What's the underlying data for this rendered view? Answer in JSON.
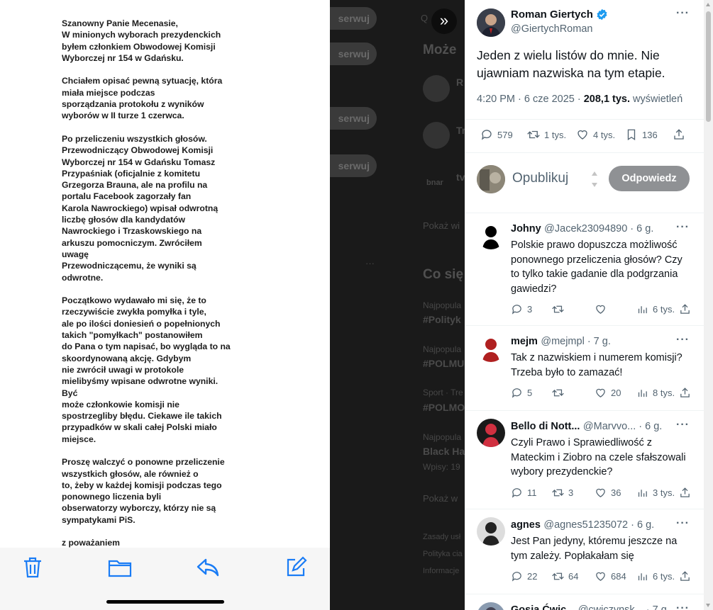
{
  "letter": {
    "paragraphs": [
      [
        "Szanowny Panie Mecenasie,",
        "W minionych wyborach prezydenckich",
        "byłem członkiem Obwodowej Komisji",
        "Wyborczej nr 154 w Gdańsku."
      ],
      [
        "Chciałem opisać pewną sytuację, która",
        "miała miejsce podczas",
        "sporządzania protokołu z wyników",
        "wyborów w II turze 1 czerwca."
      ],
      [
        "Po przeliczeniu wszystkich głosów.",
        "Przewodniczący Obwodowej Komisji",
        "Wyborczej nr 154 w Gdańsku Tomasz",
        "Przypaśniak (oficjalnie z komitetu",
        "Grzegorza Brauna, ale na profilu na",
        "portalu Facebook zagorzały fan",
        "Karola Nawrockiego) wpisał odwrotną",
        "liczbę głosów dla kandydatów",
        "Nawrockiego i Trzaskowskiego na",
        "arkuszu pomocniczym. Zwróciłem",
        "uwagę",
        "Przewodniczącemu, że wyniki są",
        "odwrotne."
      ],
      [
        "Początkowo wydawało mi się, że to",
        "rzeczywiście zwykła pomyłka i tyle,",
        "ale po ilości doniesień o popełnionych",
        "takich \"pomyłkach\" postanowiłem",
        "do Pana o tym napisać, bo wygląda to na",
        "skoordynowaną akcję. Gdybym",
        "nie zwrócił uwagi w protokole",
        "mielibyśmy wpisane odwrotne wyniki.",
        "Być",
        "może członkowie komisji nie",
        "spostrzegliby błędu. Ciekawe ile takich",
        "przypadków w skali całej Polski miało",
        "miejsce."
      ],
      [
        "Proszę walczyć o ponowne przeliczenie",
        "wszystkich głosów, ale również o",
        "to, żeby w każdej komisji podczas tego",
        "ponownego liczenia byli",
        "obserwatorzy wyborczy, którzy nie są",
        "sympatykami PiS."
      ],
      [
        "z poważaniem"
      ]
    ]
  },
  "backdrop": {
    "follow_label": "serwuj",
    "who_to_follow_heading": "Może",
    "show_more": "Pokaż wi",
    "trends_heading": "Co się",
    "trends": [
      {
        "meta": "Najpopula",
        "tag": "#Polityk"
      },
      {
        "meta": "Najpopula",
        "tag": "#POLMU"
      },
      {
        "meta": "Sport · Tre",
        "tag": "#POLMO"
      },
      {
        "meta": "Najpopula",
        "tag": "Black Ha"
      }
    ],
    "trend_sub": "Wpisy: 19",
    "show_more_2": "Pokaż w",
    "footer": [
      "Zasady usł",
      "Polityka cia",
      "Informacje"
    ],
    "account_initials": [
      "R",
      "Tr",
      "tv"
    ],
    "account_logo": "bnar",
    "search_hint": "Q",
    "dots": "···"
  },
  "tweet": {
    "author": "Roman Giertych",
    "handle": "@GiertychRoman",
    "text": "Jeden z wielu listów do mnie. Nie ujawniam nazwiska na tym etapie.",
    "time": "4:20 PM · 6 cze 2025 · ",
    "views_count": "208,1 tys.",
    "views_label": " wyświetleń",
    "stats": {
      "replies": "579",
      "reposts": "1 tys.",
      "likes": "4 tys.",
      "bookmarks": "136"
    },
    "verified_color": "#1d9bf0"
  },
  "composer": {
    "placeholder": "Opublikuj",
    "reply_button": "Odpowiedz"
  },
  "replies": [
    {
      "name": "Johny",
      "handle": "@Jacek23094890",
      "time": " · 6 g.",
      "text": "Polskie prawo dopuszcza możliwość ponownego przeliczenia głosów? Czy to tylko takie gadanie dla podgrzania gawiedzi?",
      "replies": "3",
      "reposts": "",
      "likes": "",
      "views": "6 tys."
    },
    {
      "name": "mejm",
      "handle": "@mejmpl",
      "time": " · 7 g.",
      "text": "Tak z nazwiskiem i numerem komisji? Trzeba było to zamazać!",
      "replies": "5",
      "reposts": "",
      "likes": "20",
      "views": "8 tys."
    },
    {
      "name": "Bello di Nott...",
      "handle": "@Marvvo...",
      "time": " · 6 g.",
      "text": "Czyli Prawo i Sprawiedliwość z Mateckim i Ziobro na czele sfałszowali wybory prezydenckie?",
      "replies": "11",
      "reposts": "3",
      "likes": "36",
      "views": "3 tys."
    },
    {
      "name": "agnes",
      "handle": "@agnes51235072",
      "time": " · 6 g.",
      "text": "Jest Pan jedyny, któremu jeszcze na tym zależy. Popłakałam się",
      "replies": "22",
      "reposts": "64",
      "likes": "684",
      "views": "6 tys."
    },
    {
      "name": "Gosia Ćwic...",
      "handle": "@cwiczynsk...",
      "time": " · 7 g.",
      "text": "",
      "replies": "",
      "reposts": "",
      "likes": "",
      "views": ""
    }
  ]
}
